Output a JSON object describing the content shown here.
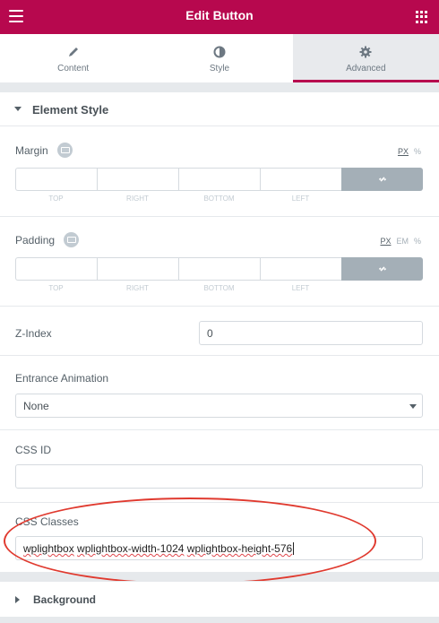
{
  "header": {
    "title": "Edit Button",
    "menu_icon": "hamburger-icon",
    "apps_icon": "grid-icon"
  },
  "tabs": [
    {
      "label": "Content",
      "icon": "pencil-icon",
      "active": false
    },
    {
      "label": "Style",
      "icon": "half-circle-icon",
      "active": false
    },
    {
      "label": "Advanced",
      "icon": "gear-icon",
      "active": true
    }
  ],
  "section": {
    "title": "Element Style"
  },
  "margin": {
    "label": "Margin",
    "units": [
      "PX",
      "%"
    ],
    "active_unit": "PX",
    "fields": [
      "TOP",
      "RIGHT",
      "BOTTOM",
      "LEFT"
    ]
  },
  "padding": {
    "label": "Padding",
    "units": [
      "PX",
      "EM",
      "%"
    ],
    "active_unit": "PX",
    "fields": [
      "TOP",
      "RIGHT",
      "BOTTOM",
      "LEFT"
    ]
  },
  "zindex": {
    "label": "Z-Index",
    "value": "0"
  },
  "animation": {
    "label": "Entrance Animation",
    "value": "None"
  },
  "css_id": {
    "label": "CSS ID",
    "value": ""
  },
  "css_classes": {
    "label": "CSS Classes",
    "value_parts": [
      "wplightbox",
      " ",
      "wplightbox-width-1024",
      " ",
      "wplightbox-height-576"
    ]
  },
  "background": {
    "title": "Background"
  },
  "colors": {
    "brand": "#b7084e",
    "annotation": "#e03a2f"
  }
}
